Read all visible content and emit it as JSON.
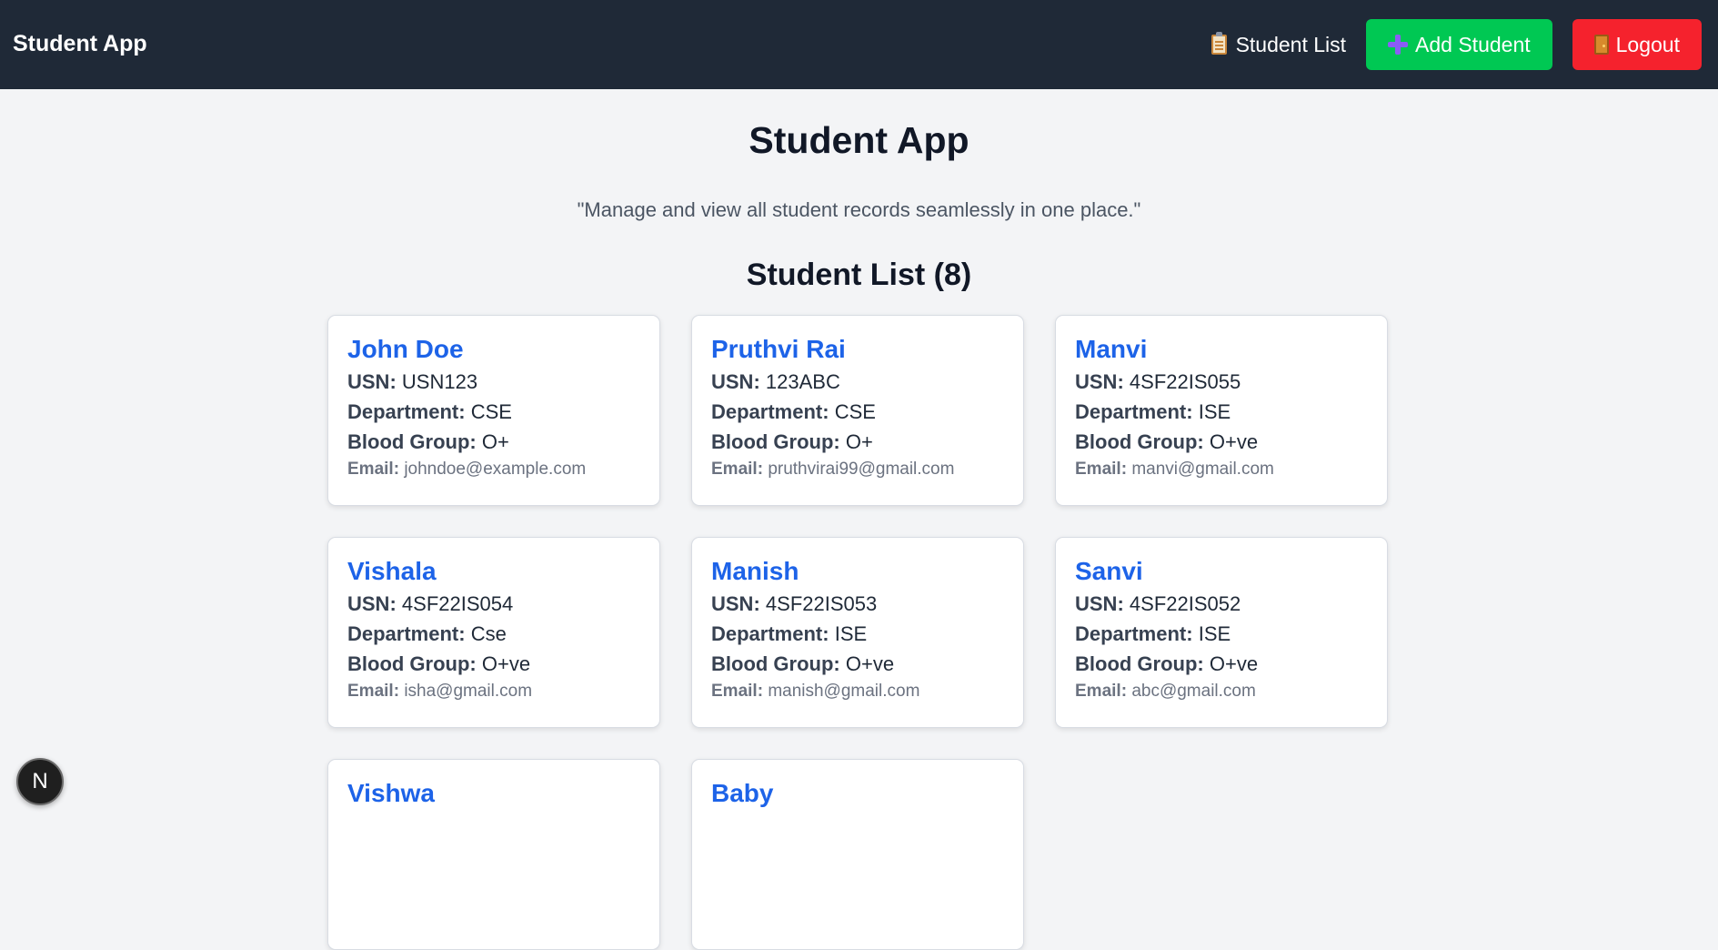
{
  "navbar": {
    "brand": "Student App",
    "student_list_label": "Student List",
    "add_student_label": "Add Student",
    "logout_label": "Logout",
    "icons": {
      "student_list": "clipboard-icon",
      "add_student": "plus-icon",
      "logout": "door-icon"
    },
    "colors": {
      "background": "#1f2937",
      "add_button": "#00c853",
      "logout_button": "#f5222d"
    }
  },
  "main": {
    "title": "Student App",
    "tagline": "\"Manage and view all student records seamlessly in one place.\"",
    "list_heading": "Student List (8)"
  },
  "labels": {
    "usn": "USN:",
    "department": "Department:",
    "blood_group": "Blood Group:",
    "email": "Email:"
  },
  "students": [
    {
      "name": "John Doe",
      "usn": "USN123",
      "department": "CSE",
      "blood_group": "O+",
      "email": "johndoe@example.com"
    },
    {
      "name": "Pruthvi Rai",
      "usn": "123ABC",
      "department": "CSE",
      "blood_group": "O+",
      "email": "pruthvirai99@gmail.com"
    },
    {
      "name": "Manvi",
      "usn": "4SF22IS055",
      "department": "ISE",
      "blood_group": "O+ve",
      "email": "manvi@gmail.com"
    },
    {
      "name": "Vishala",
      "usn": "4SF22IS054",
      "department": "Cse",
      "blood_group": "O+ve",
      "email": "isha@gmail.com"
    },
    {
      "name": "Manish",
      "usn": "4SF22IS053",
      "department": "ISE",
      "blood_group": "O+ve",
      "email": "manish@gmail.com"
    },
    {
      "name": "Sanvi",
      "usn": "4SF22IS052",
      "department": "ISE",
      "blood_group": "O+ve",
      "email": "abc@gmail.com"
    },
    {
      "name": "Vishwa"
    },
    {
      "name": "Baby"
    }
  ],
  "dev_badge": {
    "label": "N"
  }
}
